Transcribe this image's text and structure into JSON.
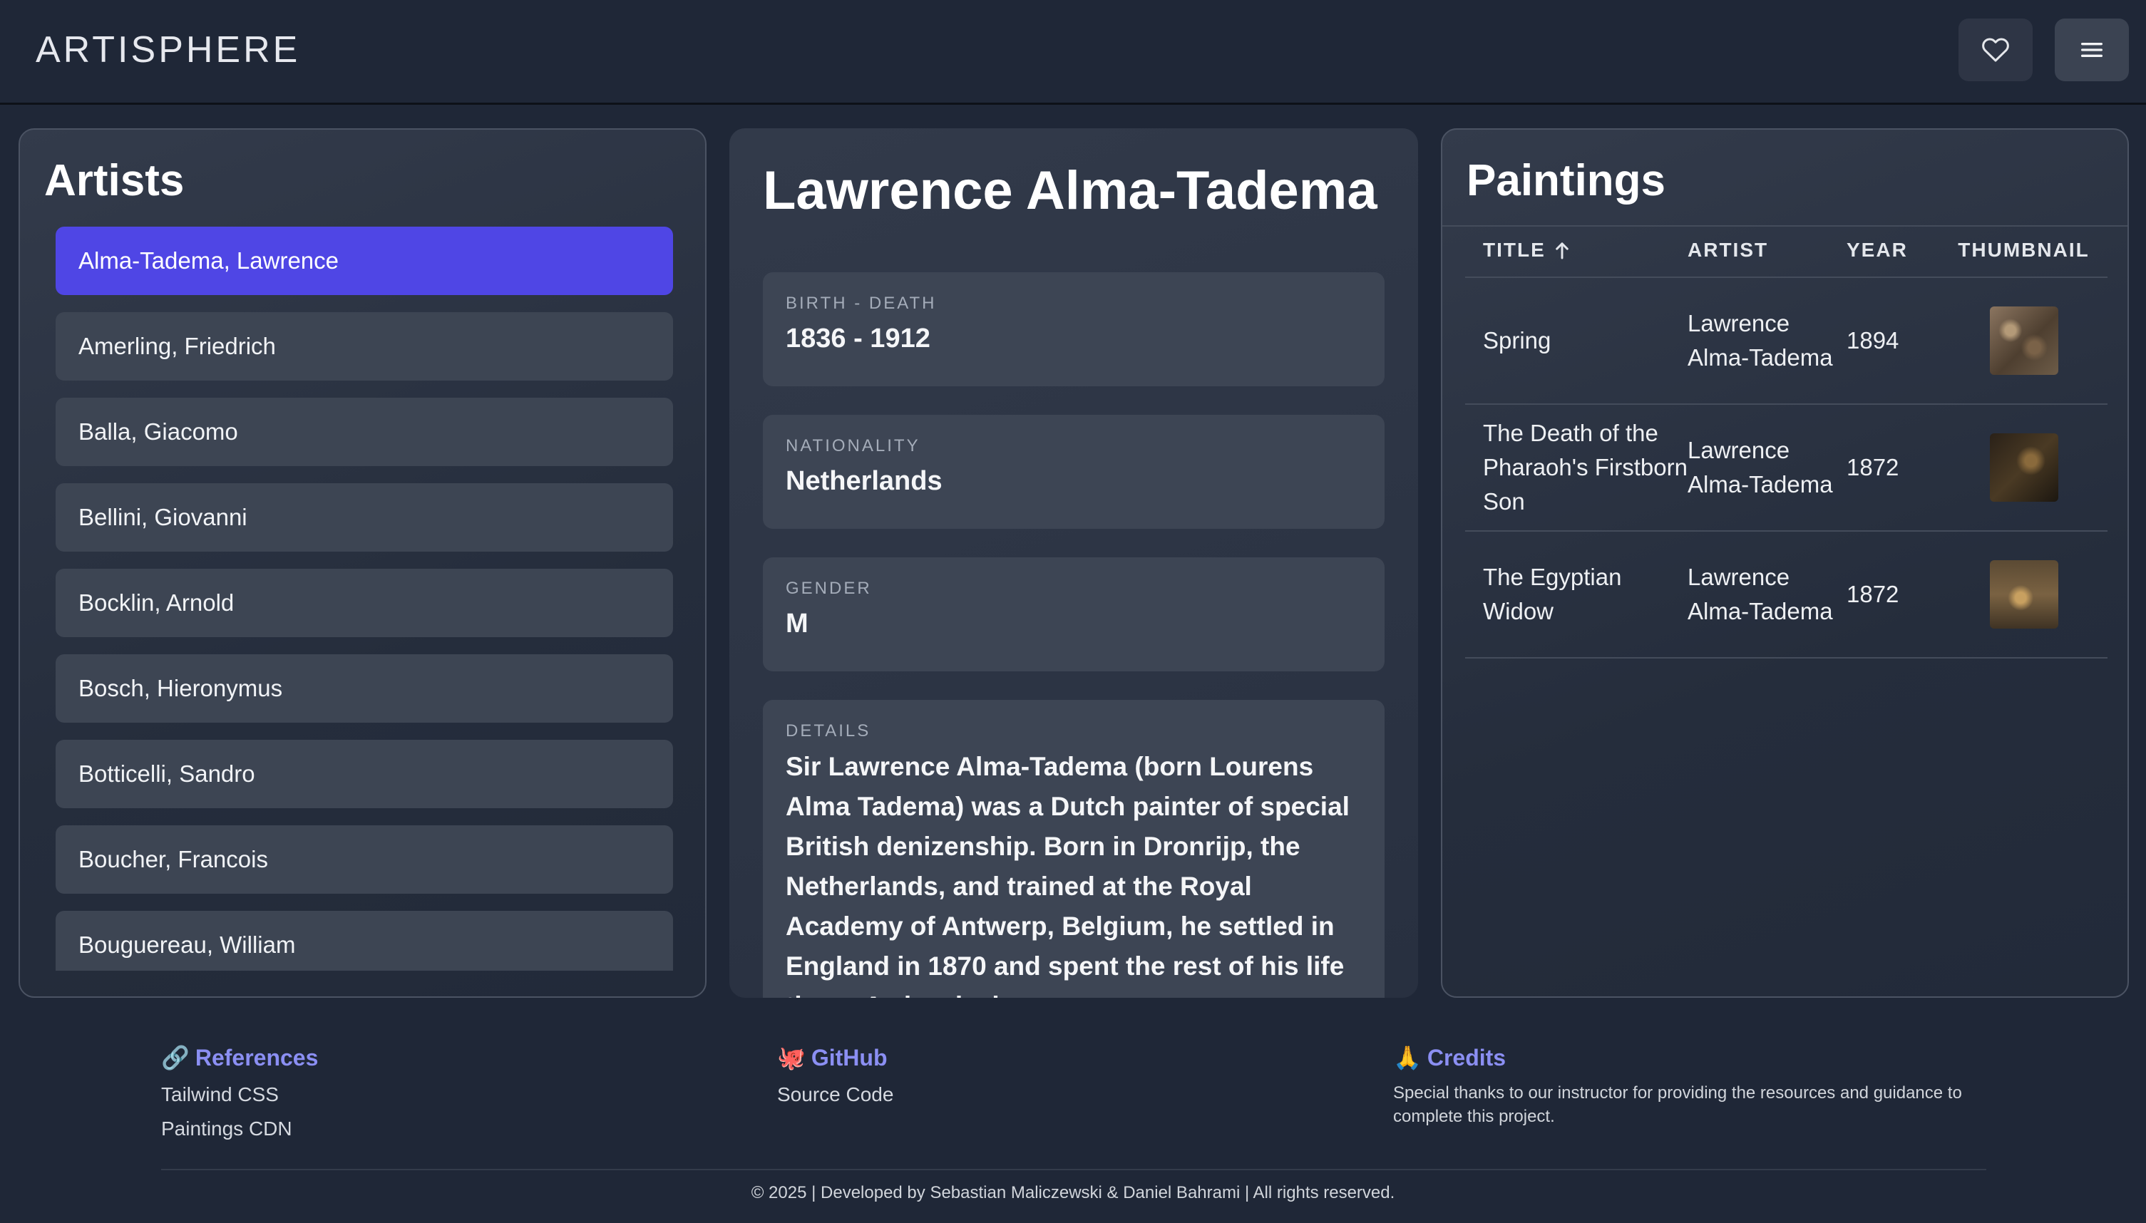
{
  "header": {
    "logo": "ARTISPHERE",
    "favorites_icon": "heart-icon",
    "menu_icon": "hamburger-menu-icon"
  },
  "artists": {
    "title": "Artists",
    "items": [
      {
        "label": "Alma-Tadema, Lawrence",
        "selected": true
      },
      {
        "label": "Amerling, Friedrich",
        "selected": false
      },
      {
        "label": "Balla, Giacomo",
        "selected": false
      },
      {
        "label": "Bellini, Giovanni",
        "selected": false
      },
      {
        "label": "Bocklin, Arnold",
        "selected": false
      },
      {
        "label": "Bosch, Hieronymus",
        "selected": false
      },
      {
        "label": "Botticelli, Sandro",
        "selected": false
      },
      {
        "label": "Boucher, Francois",
        "selected": false
      },
      {
        "label": "Bouguereau, William",
        "selected": false
      }
    ]
  },
  "detail": {
    "name": "Lawrence Alma-Tadema",
    "birth_death_label": "BIRTH - DEATH",
    "birth_death": "1836 - 1912",
    "nationality_label": "NATIONALITY",
    "nationality": "Netherlands",
    "gender_label": "GENDER",
    "gender": "M",
    "details_label": "DETAILS",
    "details": "Sir Lawrence Alma-Tadema (born Lourens Alma Tadema) was a Dutch painter of special British denizenship. Born in Dronrijp, the Netherlands, and trained at the Royal Academy of Antwerp, Belgium, he settled in England in 1870 and spent the rest of his life there. A classical-"
  },
  "paintings": {
    "title": "Paintings",
    "columns": {
      "title": "TITLE",
      "artist": "ARTIST",
      "year": "YEAR",
      "thumbnail": "THUMBNAIL"
    },
    "sort_icon": "arrow-up-icon",
    "rows": [
      {
        "title": "Spring",
        "artist": "Lawrence Alma-Tadema",
        "year": "1894"
      },
      {
        "title": "The Death of the Pharaoh's Firstborn Son",
        "artist": "Lawrence Alma-Tadema",
        "year": "1872"
      },
      {
        "title": "The Egyptian Widow",
        "artist": "Lawrence Alma-Tadema",
        "year": "1872"
      }
    ]
  },
  "footer": {
    "references": {
      "emoji": "🔗",
      "heading": "References",
      "links": [
        "Tailwind CSS",
        "Paintings CDN"
      ]
    },
    "github": {
      "emoji": "🐙",
      "heading": "GitHub",
      "link": "Source Code"
    },
    "credits": {
      "emoji": "🙏",
      "heading": "Credits",
      "text": "Special thanks to our instructor for providing the resources and guidance to complete this project."
    },
    "copyright": "© 2025 | Developed by Sebastian Maliczewski & Daniel Bahrami | All rights reserved."
  },
  "colors": {
    "background": "#1f2737",
    "accent": "#4f46e5",
    "footer_link": "#8b8ff3"
  }
}
